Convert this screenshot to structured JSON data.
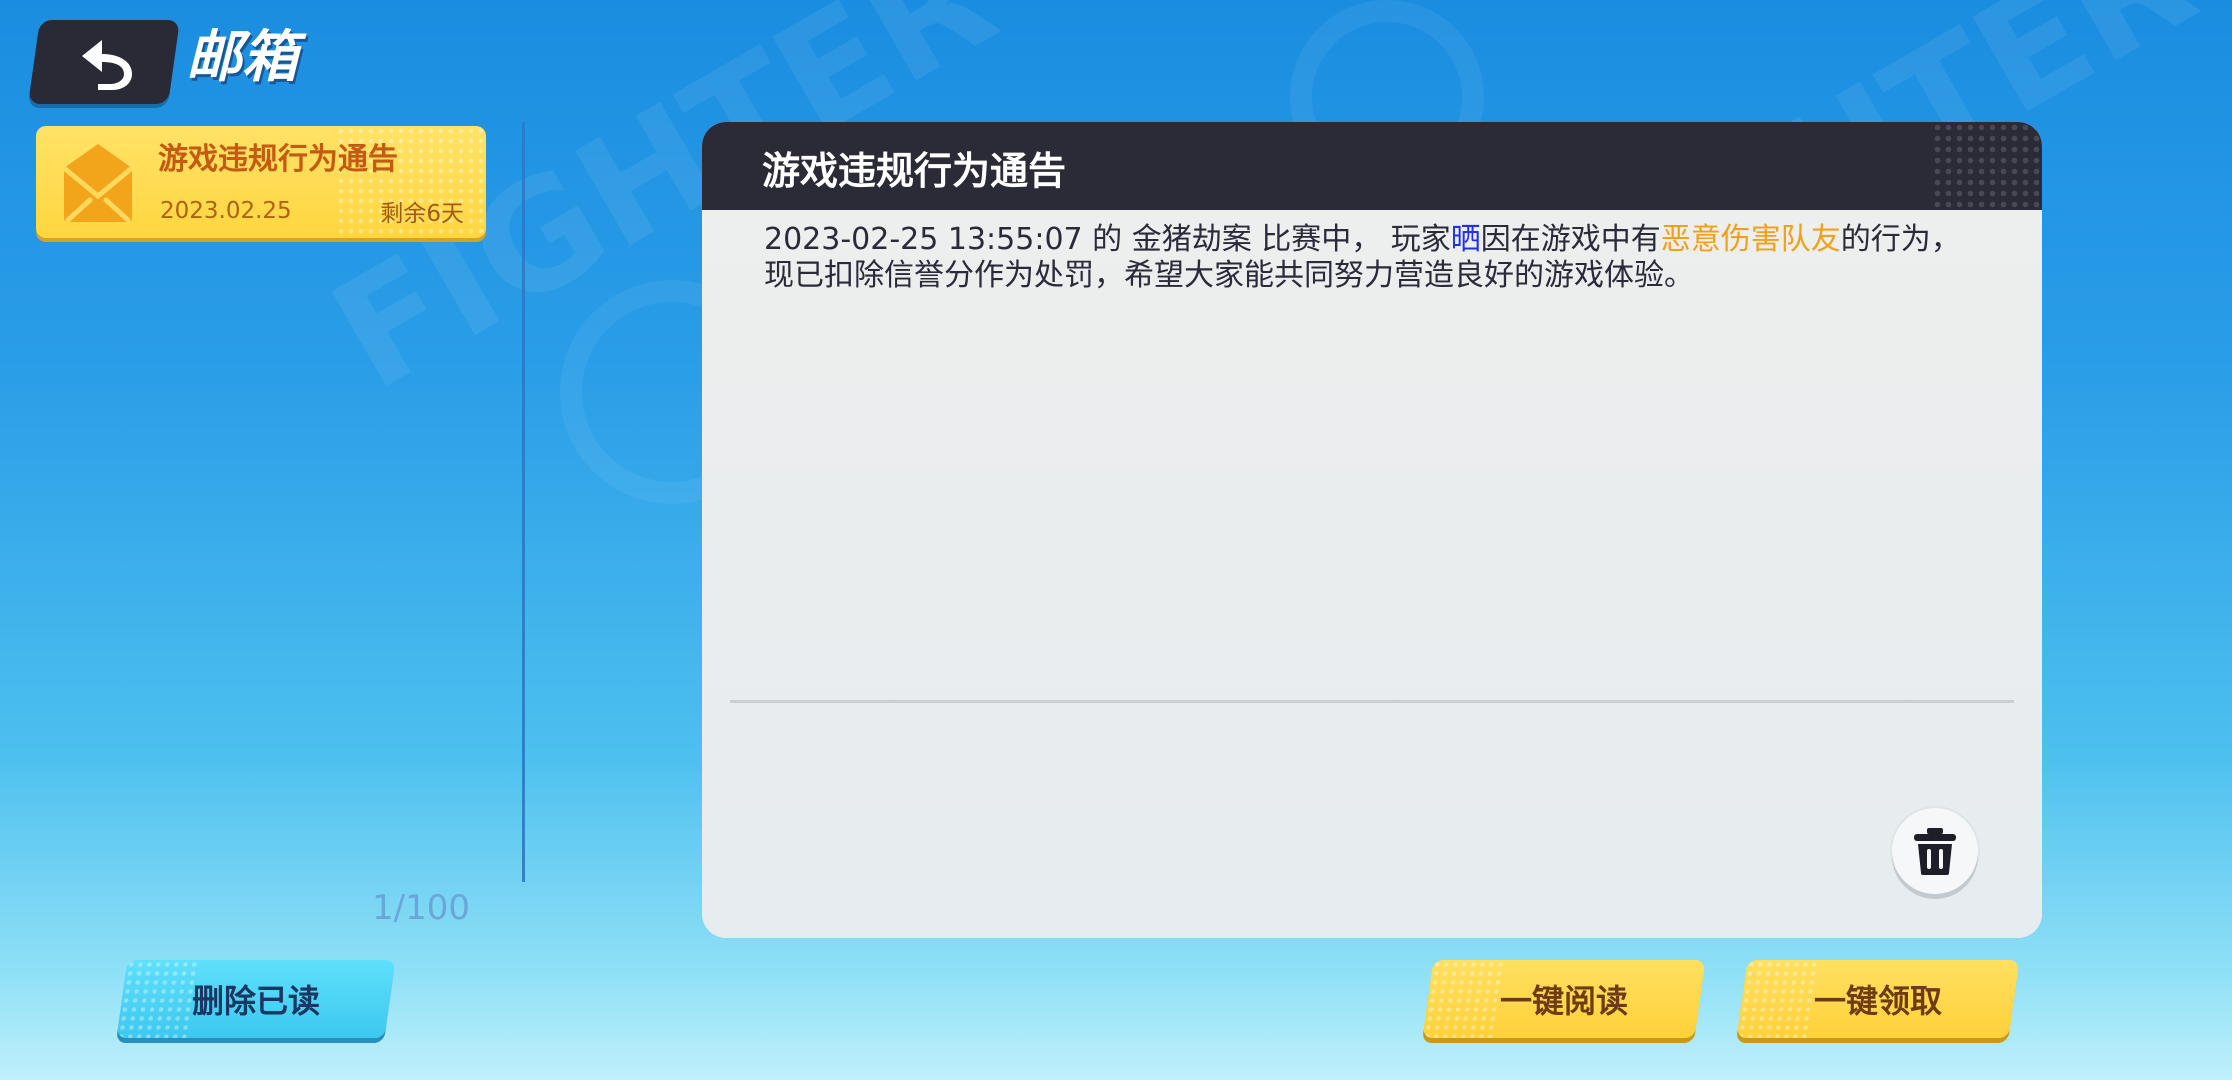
{
  "header": {
    "title": "邮箱",
    "back_icon": "back-arrow-icon"
  },
  "mail_list": {
    "items": [
      {
        "title": "游戏违规行为通告",
        "date": "2023.02.25",
        "remaining": "剩余6天",
        "icon": "envelope-icon"
      }
    ],
    "count": "1/100"
  },
  "message": {
    "title": "游戏违规行为通告",
    "body_prefix": "2023-02-25 13:55:07 的 金猪劫案 比赛中， 玩家",
    "player": "晒",
    "body_middle": "因在游戏中有",
    "violation": "恶意伤害队友",
    "body_suffix": "的行为，现已扣除信誉分作为处罚，希望大家能共同努力营造良好的游戏体验。",
    "delete_icon": "trash-icon"
  },
  "buttons": {
    "delete_read": "删除已读",
    "read_all": "一键阅读",
    "claim_all": "一键领取"
  },
  "colors": {
    "background_top": "#1b8de0",
    "background_bottom": "#bff0fb",
    "card_yellow": "#ffd640",
    "header_dark": "#2b2a37",
    "player_name": "#1f2ff0",
    "violation_text": "#f2a017",
    "cyan_button": "#3cc8ef"
  }
}
